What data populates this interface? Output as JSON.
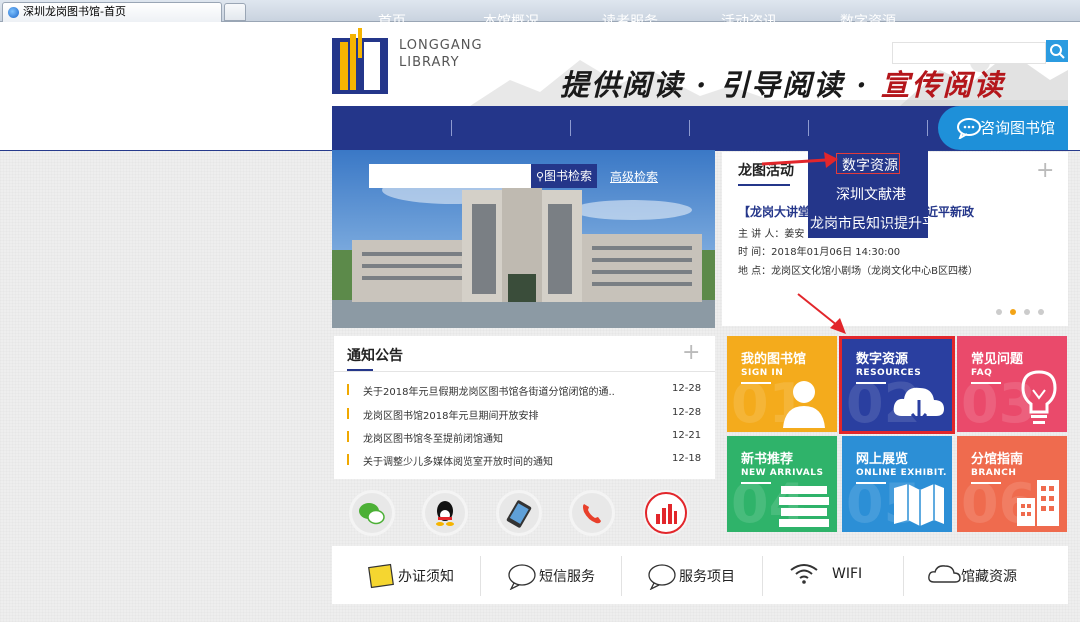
{
  "browser": {
    "tab_title": "深圳龙岗图书馆-首页"
  },
  "header": {
    "logo_line1": "LONGGANG",
    "logo_line2": "LIBRARY",
    "slogan_part1": "提供阅读 · 引导阅读 ·",
    "slogan_part2": "宣传阅读"
  },
  "nav": {
    "items": [
      "首页",
      "本馆概况",
      "读者服务",
      "活动咨讯",
      "数字资源"
    ],
    "consult": "咨询图书馆"
  },
  "banner": {
    "search_btn": "图书检索",
    "advanced": "高级检索"
  },
  "dropdown": {
    "items": [
      "数字资源",
      "深圳文献港",
      "龙岗市民知识提升平"
    ]
  },
  "activity": {
    "title": "龙图活动",
    "headline_start": "【龙岗大讲堂",
    "headline_end": "近平新政",
    "speaker": "主 讲 人：姜安",
    "time": "时  间：2018年01月06日 14:30:00",
    "place": "地  点：龙岗区文化馆小剧场（龙岗文化中心B区四楼）"
  },
  "notice": {
    "title": "通知公告",
    "items": [
      {
        "text": "关于2018年元旦假期龙岗区图书馆各街道分馆闭馆的通..",
        "date": "12-28"
      },
      {
        "text": "龙岗区图书馆2018年元旦期间开放安排",
        "date": "12-28"
      },
      {
        "text": "龙岗区图书馆冬至提前闭馆通知",
        "date": "12-21"
      },
      {
        "text": "关于调整少儿多媒体阅览室开放时间的通知",
        "date": "12-18"
      }
    ]
  },
  "tiles": [
    {
      "title": "我的图书馆",
      "sub": "SIGN IN",
      "num": "01",
      "color": "#f4ab1c",
      "icon": "person-icon"
    },
    {
      "title": "数字资源",
      "sub": "RESOURCES",
      "num": "02",
      "color": "#2a3fa0",
      "icon": "cloud-download-icon"
    },
    {
      "title": "常见问题",
      "sub": "FAQ",
      "num": "03",
      "color": "#ea4a6b",
      "icon": "lightbulb-icon"
    },
    {
      "title": "新书推荐",
      "sub": "NEW ARRIVALS",
      "num": "04",
      "color": "#2fb36a",
      "icon": "books-icon"
    },
    {
      "title": "网上展览",
      "sub": "ONLINE EXHIBIT.",
      "num": "05",
      "color": "#2c8fd6",
      "icon": "map-icon"
    },
    {
      "title": "分馆指南",
      "sub": "BRANCH",
      "num": "06",
      "color": "#ef6b4e",
      "icon": "building-icon"
    }
  ],
  "bottom": {
    "items": [
      "办证须知",
      "短信服务",
      "服务项目",
      "WIFI",
      "馆藏资源"
    ]
  }
}
